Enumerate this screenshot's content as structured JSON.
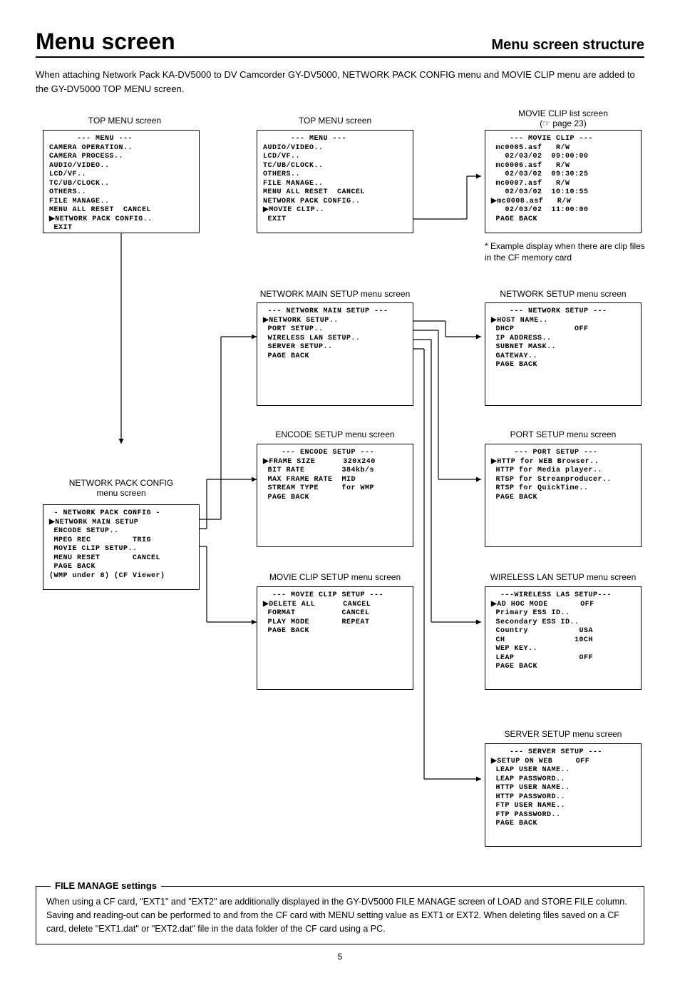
{
  "header": {
    "title": "Menu screen",
    "subtitle": "Menu screen structure"
  },
  "intro": "When attaching Network Pack KA-DV5000 to DV Camcorder GY-DV5000, NETWORK PACK CONFIG menu and MOVIE CLIP menu are added to the GY-DV5000 TOP MENU screen.",
  "labels": {
    "top1": "TOP MENU screen",
    "top2": "TOP MENU screen",
    "movie_clip_list": "MOVIE CLIP list screen",
    "movie_clip_ref": "(☞ page 23)",
    "network_main": "NETWORK MAIN SETUP menu screen",
    "network_setup": "NETWORK SETUP menu screen",
    "encode": "ENCODE SETUP menu screen",
    "port": "PORT SETUP menu screen",
    "npc_label_1": "NETWORK PACK CONFIG",
    "npc_label_2": "menu screen",
    "movie_clip_setup": "MOVIE CLIP SETUP menu screen",
    "wireless": "WIRELESS LAN SETUP menu screen",
    "server": "SERVER SETUP menu screen"
  },
  "boxes": {
    "top1": "      --- MENU ---\nCAMERA OPERATION..\nCAMERA PROCESS..\nAUDIO/VIDEO..\nLCD/VF..\nTC/UB/CLOCK..\nOTHERS..\nFILE MANAGE..\nMENU ALL RESET  CANCEL\n▶NETWORK PACK CONFIG..\n EXIT",
    "top2": "      --- MENU ---\nAUDIO/VIDEO..\nLCD/VF..\nTC/UB/CLOCK..\nOTHERS..\nFILE MANAGE..\nMENU ALL RESET  CANCEL\nNETWORK PACK CONFIG..\n▶MOVIE CLIP..\n EXIT",
    "movie_clip_list": "    --- MOVIE CLIP ---\n mc0005.asf   R/W\n   02/03/02  09:00:00\n mc0006.asf   R/W\n   02/03/02  09:30:25\n mc0007.asf   R/W\n   02/03/02  10:10:55\n▶mc0008.asf   R/W\n   02/03/02  11:00:00\n PAGE BACK",
    "network_main": " --- NETWORK MAIN SETUP ---\n▶NETWORK SETUP..\n PORT SETUP..\n WIRELESS LAN SETUP..\n SERVER SETUP..\n PAGE BACK",
    "network_setup": "    --- NETWORK SETUP ---\n▶HOST NAME..\n DHCP             OFF\n IP ADDRESS..\n SUBNET MASK..\n GATEWAY..\n PAGE BACK",
    "encode": "    --- ENCODE SETUP ---\n▶FRAME SIZE      320x240\n BIT RATE        384kb/s\n MAX FRAME RATE  MID\n STREAM TYPE     for WMP\n PAGE BACK",
    "port": "     --- PORT SETUP ---\n▶HTTP for WEB Browser..\n HTTP for Media player..\n RTSP for Streamproducer..\n RTSP for QuickTime..\n PAGE BACK",
    "npc": " - NETWORK PACK CONFIG -\n▶NETWORK MAIN SETUP\n ENCODE SETUP..\n MPEG REC         TRIG\n MOVIE CLIP SETUP..\n MENU RESET       CANCEL\n PAGE BACK\n(WMP under 8) (CF Viewer)",
    "movie_clip_setup": "  --- MOVIE CLIP SETUP ---\n▶DELETE ALL      CANCEL\n FORMAT          CANCEL\n PLAY MODE       REPEAT\n PAGE BACK",
    "wireless": "  ---WIRELESS LAS SETUP---\n▶AD HOC MODE       OFF\n Primary ESS ID..\n Secondary ESS ID..\n Country           USA\n CH               10CH\n WEP KEY..\n LEAP              OFF\n PAGE BACK",
    "server": "    --- SERVER SETUP ---\n▶SETUP ON WEB     OFF\n LEAP USER NAME..\n LEAP PASSWORD..\n HTTP USER NAME..\n HTTP PASSWORD..\n FTP USER NAME..\n FTP PASSWORD..\n PAGE BACK"
  },
  "note": "*  Example display when there are clip files in the CF memory card",
  "footer": {
    "title": "FILE MANAGE settings",
    "body": "When using a CF card, \"EXT1\" and \"EXT2\" are additionally displayed in the GY-DV5000 FILE MANAGE screen of LOAD and STORE FILE column. Saving and reading-out can be performed to and from the CF card with MENU setting value as EXT1 or EXT2. When deleting files saved on a CF card, delete \"EXT1.dat\" or \"EXT2.dat\" file in the data folder of the CF card using a PC."
  },
  "page_number": "5"
}
